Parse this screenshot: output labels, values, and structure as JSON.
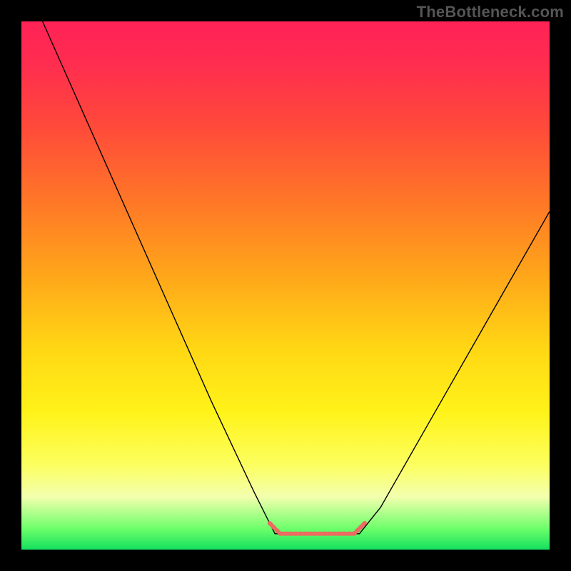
{
  "watermark": "TheBottleneck.com",
  "chart_data": {
    "type": "line",
    "title": "",
    "xlabel": "",
    "ylabel": "",
    "x_range": [
      0,
      100
    ],
    "y_range": [
      0,
      100
    ],
    "series": [
      {
        "name": "curve",
        "color": "#000000",
        "stroke_width": 1.4,
        "points": [
          {
            "x": 4,
            "y": 100
          },
          {
            "x": 12,
            "y": 82
          },
          {
            "x": 20,
            "y": 64
          },
          {
            "x": 28,
            "y": 46
          },
          {
            "x": 36,
            "y": 28
          },
          {
            "x": 44,
            "y": 11
          },
          {
            "x": 48,
            "y": 3
          },
          {
            "x": 52,
            "y": 3
          },
          {
            "x": 56,
            "y": 3
          },
          {
            "x": 60,
            "y": 3
          },
          {
            "x": 64,
            "y": 3
          },
          {
            "x": 68,
            "y": 8
          },
          {
            "x": 76,
            "y": 22
          },
          {
            "x": 84,
            "y": 36
          },
          {
            "x": 92,
            "y": 50
          },
          {
            "x": 100,
            "y": 64
          }
        ]
      },
      {
        "name": "highlight-segment",
        "color": "#eb6b61",
        "stroke_width": 6,
        "points": [
          {
            "x": 47,
            "y": 5
          },
          {
            "x": 49,
            "y": 3
          },
          {
            "x": 56,
            "y": 3
          },
          {
            "x": 63,
            "y": 3
          },
          {
            "x": 65,
            "y": 5
          }
        ]
      }
    ],
    "gradient_stops": [
      {
        "pos": 0,
        "color": "#ff2257"
      },
      {
        "pos": 8,
        "color": "#ff2d4f"
      },
      {
        "pos": 20,
        "color": "#ff4a3a"
      },
      {
        "pos": 35,
        "color": "#ff7a26"
      },
      {
        "pos": 48,
        "color": "#ffa61a"
      },
      {
        "pos": 62,
        "color": "#ffd714"
      },
      {
        "pos": 74,
        "color": "#fff319"
      },
      {
        "pos": 84,
        "color": "#fcff60"
      },
      {
        "pos": 90,
        "color": "#f3ffae"
      },
      {
        "pos": 96,
        "color": "#6dff6b"
      },
      {
        "pos": 100,
        "color": "#14e05e"
      }
    ]
  }
}
